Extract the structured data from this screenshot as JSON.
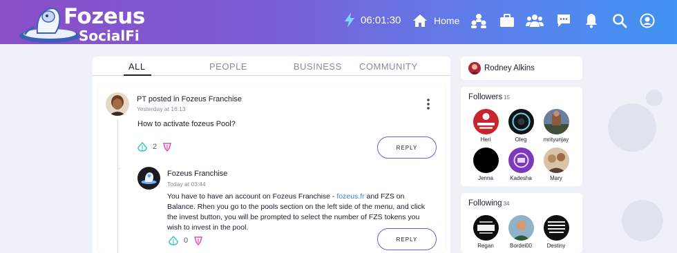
{
  "app": {
    "brand_line1": "Fozeus",
    "brand_line2": "SocialFi",
    "brand_colors": {
      "gradient_start": "#8a4ec6",
      "gradient_end": "#3f93f2"
    }
  },
  "header": {
    "clock": "06:01:30",
    "home_label": "Home",
    "icons": [
      "bolt-icon",
      "home-icon",
      "people-group-icon",
      "briefcase-icon",
      "users-icon",
      "chat-icon",
      "bell-icon",
      "search-icon",
      "account-icon"
    ]
  },
  "feed": {
    "tabs": [
      {
        "label": "ALL",
        "active": true
      },
      {
        "label": "PEOPLE",
        "active": false
      },
      {
        "label": "BUSINESS",
        "active": false
      },
      {
        "label": "COMMUNITY",
        "active": false
      }
    ],
    "post": {
      "author_line": "PT posted in Fozeus Franchise",
      "time": "Yesterday at 16:13",
      "text": "How to activate fozeus Pool?",
      "likes": "2",
      "reply_label": "REPLY"
    },
    "reply": {
      "author": "Fozeus Franchise",
      "time": "Today at 03:44",
      "text_before_link": "You have to have an account on Fozeus Franchise - ",
      "link": "fozeus.fr",
      "text_after_link": " and FZS on Balance. Rhen you go to the pools section on the left side of the menu, and click the invest button, you will be prompted to select the number of FZS tokens you wish to invest in the pool.",
      "likes": "0",
      "reply_label": "REPLY"
    }
  },
  "sidebar": {
    "profile_name": "Rodney Alkins",
    "followers": {
      "title": "Followers",
      "count": "15",
      "people": [
        "Heri",
        "Oleg",
        "mrityunjay",
        "Jenna",
        "Kadesha",
        "Mary"
      ]
    },
    "following": {
      "title": "Following",
      "count": "34",
      "people": [
        "Regan",
        "Bordei00",
        "Destiny"
      ]
    }
  }
}
